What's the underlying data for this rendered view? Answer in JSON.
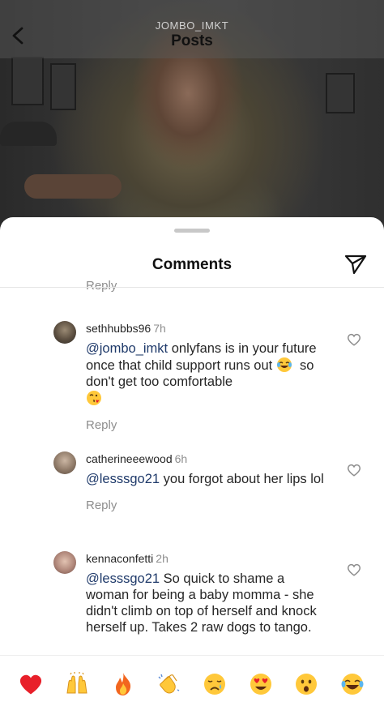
{
  "header": {
    "username": "JOMBO_IMKT",
    "title": "Posts"
  },
  "sheet": {
    "title": "Comments",
    "partial_reply_label": "Reply"
  },
  "comments": [
    {
      "username": "sethhubbs96",
      "time": "7h",
      "mention": "@jombo_imkt",
      "text_a": "onlyfans is in your future once that child support runs out",
      "text_b": "so don't get too comfortable",
      "emojis": [
        "laughing-tears-emoji",
        "kiss-heart-emoji"
      ],
      "reply_label": "Reply"
    },
    {
      "username": "catherineeewood",
      "time": "6h",
      "mention": "@lesssgo21",
      "text_a": "you forgot about her lips lol",
      "reply_label": "Reply"
    },
    {
      "username": "kennaconfetti",
      "time": "2h",
      "mention": "@lesssgo21",
      "text_a": "So quick to shame a woman for being a baby momma - she didn't climb on top of herself and knock herself up. Takes 2 raw dogs to tango."
    }
  ],
  "quick_emojis": [
    "red-heart-emoji",
    "raised-hands-emoji",
    "fire-emoji",
    "clapping-hands-emoji",
    "crying-face-emoji",
    "heart-eyes-emoji",
    "surprised-face-emoji",
    "laughing-tears-emoji"
  ],
  "colors": {
    "mention": "#1f3a6a",
    "muted": "#8e8e8e",
    "heart": "#e8202a"
  }
}
